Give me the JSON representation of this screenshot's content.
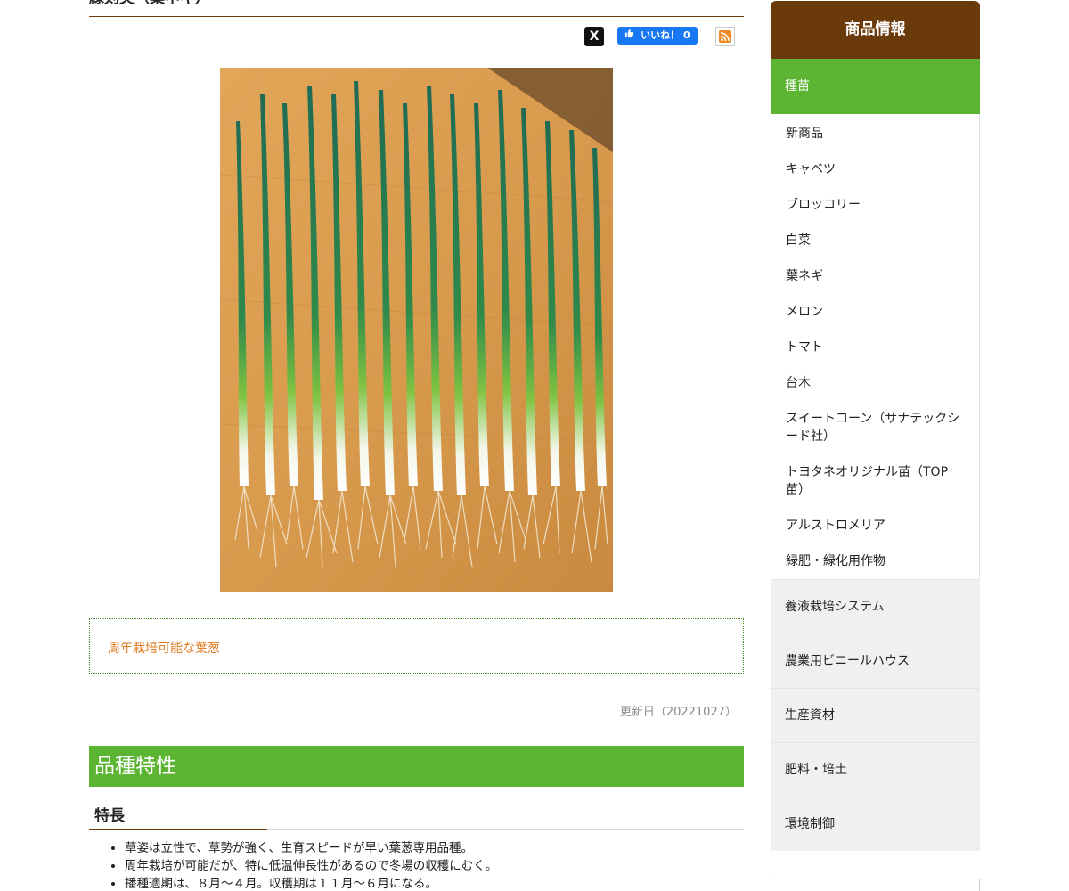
{
  "main": {
    "title": "緑剣美（葉ネギ）",
    "share": {
      "x_label": "X",
      "fb_label": "いいね！ 0"
    },
    "catch_copy": "周年栽培可能な葉葱",
    "updated": "更新日（20221027）",
    "section_title": "品種特性",
    "subsection_title": "特長",
    "features": [
      "草姿は立性で、草勢が強く、生育スピードが早い葉葱専用品種。",
      "周年栽培が可能だが、特に低温伸長性があるので冬場の収穫にむく。",
      "播種適期は、８月〜４月。収穫期は１１月〜６月になる。"
    ]
  },
  "sidebar": {
    "header": "商品情報",
    "active": "種苗",
    "subitems": [
      "新商品",
      "キャベツ",
      "ブロッコリー",
      "白菜",
      "葉ネギ",
      "メロン",
      "トマト",
      "台木",
      "スイートコーン（サナテックシード社）",
      "トヨタネオリジナル苗（TOP苗）",
      "アルストロメリア",
      "緑肥・緑化用作物"
    ],
    "categories": [
      "養液栽培システム",
      "農業用ビニールハウス",
      "生産資材",
      "肥料・培土",
      "環境制御"
    ]
  },
  "colors": {
    "brown": "#6b3a0a",
    "green": "#5bb533",
    "orange": "#e0791e"
  },
  "icons": [
    "x-logo-icon",
    "facebook-thumb-icon",
    "rss-icon"
  ]
}
